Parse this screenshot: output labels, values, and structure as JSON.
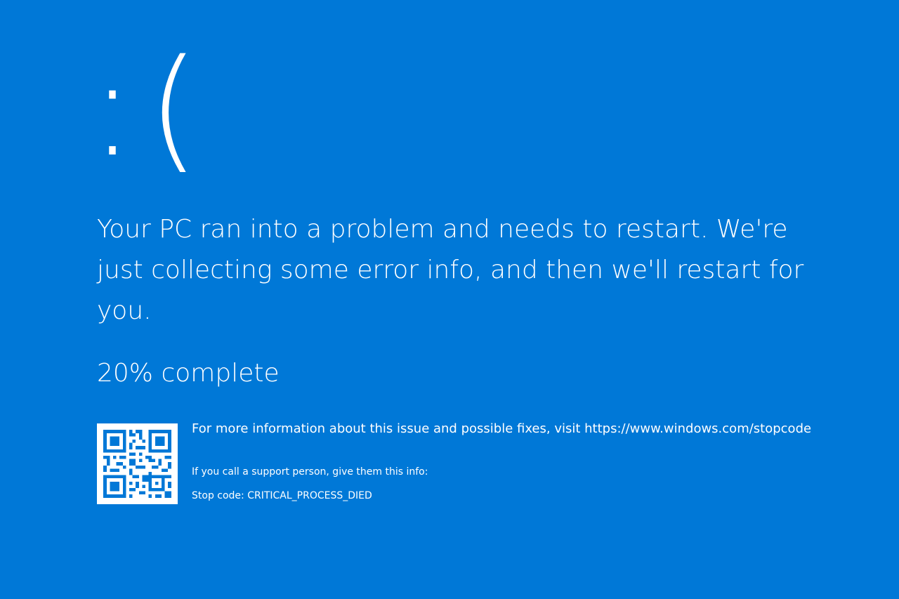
{
  "screen": {
    "background_color": "#0078d7",
    "text_color": "#ffffff"
  },
  "face": {
    "text": ":("
  },
  "message": {
    "text": "Your PC ran into a problem and needs to restart. We're just collecting some error info, and then we'll restart for you."
  },
  "progress": {
    "percent": 20,
    "label": "20% complete"
  },
  "qr_code": {
    "icon": "qr-code-icon"
  },
  "info": {
    "more_info_text": "For more information about this issue and possible fixes, visit https://www.windows.com/stopcode",
    "support_text": "If you call a support person, give them this info:",
    "stop_code_text": "Stop code: CRITICAL_PROCESS_DIED"
  }
}
